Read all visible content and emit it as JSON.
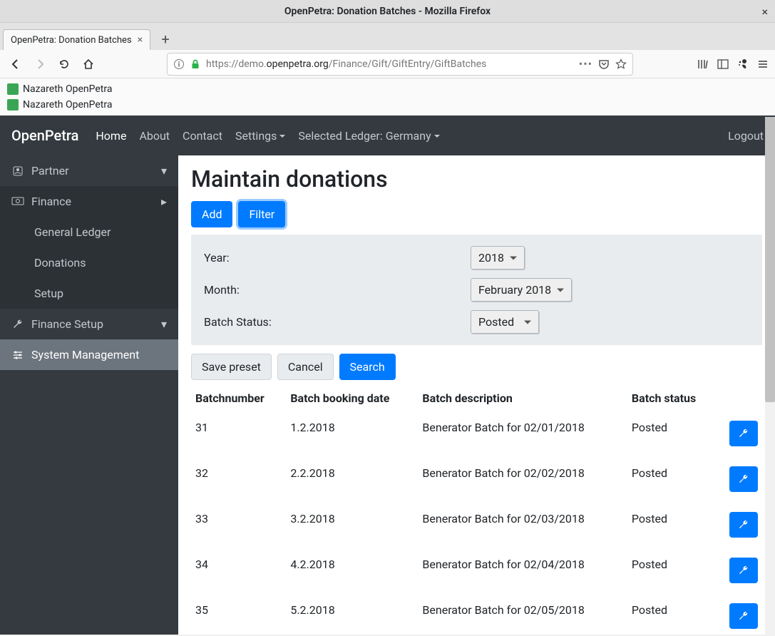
{
  "window": {
    "title": "OpenPetra: Donation Batches - Mozilla Firefox"
  },
  "tab": {
    "title": "OpenPetra: Donation Batches"
  },
  "url": {
    "prefix": "https://demo.",
    "domain": "openpetra.org",
    "path": "/Finance/Gift/GiftEntry/GiftBatches"
  },
  "bookmarks": [
    {
      "label": "Nazareth OpenPetra"
    },
    {
      "label": "Nazareth OpenPetra"
    }
  ],
  "navbar": {
    "brand": "OpenPetra",
    "home": "Home",
    "about": "About",
    "contact": "Contact",
    "settings": "Settings",
    "ledger": "Selected Ledger: Germany",
    "logout": "Logout"
  },
  "sidebar": {
    "partner": "Partner",
    "finance": "Finance",
    "general_ledger": "General Ledger",
    "donations": "Donations",
    "setup": "Setup",
    "finance_setup": "Finance Setup",
    "system_management": "System Management"
  },
  "page": {
    "title": "Maintain donations",
    "add": "Add",
    "filter": "Filter",
    "year_label": "Year:",
    "year_value": "2018",
    "month_label": "Month:",
    "month_value": "February 2018",
    "status_label": "Batch Status:",
    "status_value": "Posted",
    "save_preset": "Save preset",
    "cancel": "Cancel",
    "search": "Search"
  },
  "table": {
    "headers": {
      "number": "Batchnumber",
      "date": "Batch booking date",
      "desc": "Batch description",
      "status": "Batch status"
    },
    "rows": [
      {
        "number": "31",
        "date": "1.2.2018",
        "desc": "Benerator Batch for 02/01/2018",
        "status": "Posted"
      },
      {
        "number": "32",
        "date": "2.2.2018",
        "desc": "Benerator Batch for 02/02/2018",
        "status": "Posted"
      },
      {
        "number": "33",
        "date": "3.2.2018",
        "desc": "Benerator Batch for 02/03/2018",
        "status": "Posted"
      },
      {
        "number": "34",
        "date": "4.2.2018",
        "desc": "Benerator Batch for 02/04/2018",
        "status": "Posted"
      },
      {
        "number": "35",
        "date": "5.2.2018",
        "desc": "Benerator Batch for 02/05/2018",
        "status": "Posted"
      }
    ]
  }
}
